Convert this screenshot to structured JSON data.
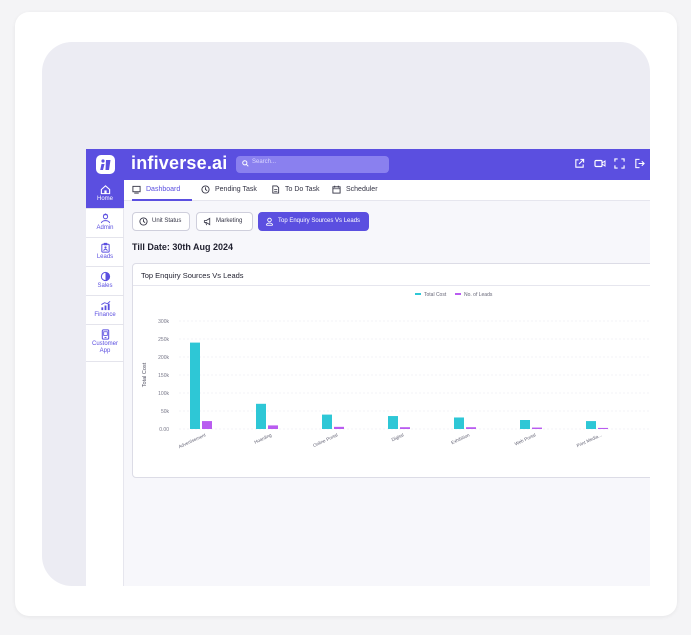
{
  "app": {
    "brand": "infiverse.ai",
    "search_placeholder": "Search..."
  },
  "colors": {
    "primary": "#5b4fe0",
    "total_cost": "#2ec7d6",
    "no_of_leads": "#b95cf0"
  },
  "topbar_icons": [
    "external-link-icon",
    "video-icon",
    "expand-icon",
    "logout-icon"
  ],
  "sidebar": {
    "items": [
      {
        "label": "Home",
        "icon": "home-icon",
        "active": true
      },
      {
        "label": "Admin",
        "icon": "admin-icon",
        "active": false
      },
      {
        "label": "Leads",
        "icon": "leads-icon",
        "active": false
      },
      {
        "label": "Sales",
        "icon": "sales-icon",
        "active": false
      },
      {
        "label": "Finance",
        "icon": "finance-icon",
        "active": false
      },
      {
        "label": "Customer App",
        "icon": "customer-app-icon",
        "active": false
      }
    ]
  },
  "tabs": [
    {
      "label": "Dashboard",
      "icon": "dashboard-icon",
      "active": true
    },
    {
      "label": "Pending Task",
      "icon": "clock-icon",
      "active": false
    },
    {
      "label": "To Do Task",
      "icon": "document-icon",
      "active": false
    },
    {
      "label": "Scheduler",
      "icon": "calendar-icon",
      "active": false
    }
  ],
  "chips": [
    {
      "label": "Unit Status",
      "icon": "clock-icon",
      "active": false
    },
    {
      "label": "Marketing",
      "icon": "megaphone-icon",
      "active": false
    },
    {
      "label": "Top Enquiry Sources Vs Leads",
      "icon": "users-icon",
      "active": true
    }
  ],
  "till_date": "Till Date: 30th Aug 2024",
  "chart_card": {
    "title": "Top Enquiry Sources Vs Leads"
  },
  "chart_data": {
    "type": "bar",
    "categories": [
      "Advertisement",
      "Hoarding",
      "Online Portal",
      "Digital",
      "Exhibition",
      "Web Portal",
      "Print Media"
    ],
    "category_labels": [
      "Advertisement",
      "Hoarding",
      "Online Portal",
      "Digital",
      "Exhibition",
      "Web Portal",
      "Print Media..."
    ],
    "series": [
      {
        "name": "Total Cost",
        "values": [
          240000,
          70000,
          40000,
          36000,
          32000,
          25000,
          22000
        ]
      },
      {
        "name": "No. of Leads",
        "values": [
          22000,
          10000,
          6000,
          5000,
          5000,
          4000,
          3000
        ]
      }
    ],
    "ylabel": "Total Cost",
    "yticks": [
      "0.00",
      "50k",
      "100k",
      "150k",
      "200k",
      "250k",
      "300k"
    ],
    "ylim": [
      0,
      300000
    ],
    "legend": "top",
    "grid": true
  }
}
